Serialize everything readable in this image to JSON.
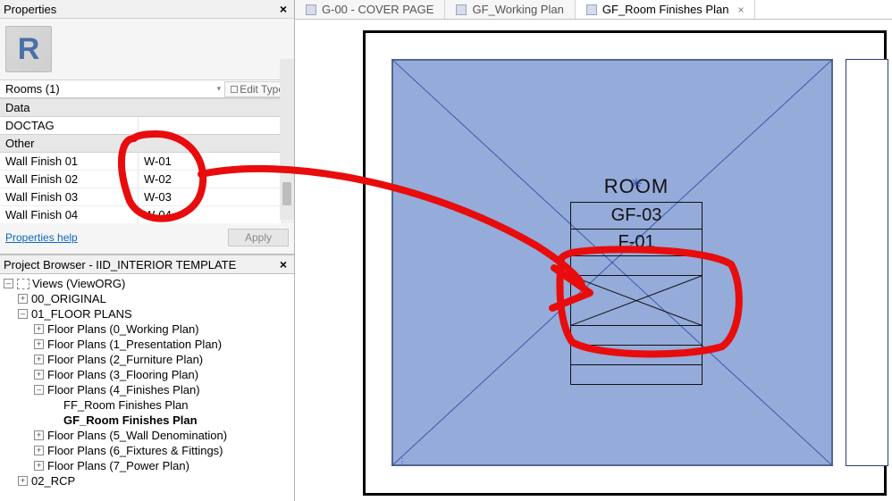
{
  "properties": {
    "panelTitle": "Properties",
    "typeLetter": "R",
    "instanceSelector": "Rooms (1)",
    "editType": "Edit Type",
    "sections": [
      {
        "title": "Data",
        "rows": [
          {
            "label": "DOCTAG",
            "value": ""
          }
        ]
      },
      {
        "title": "Other",
        "rows": [
          {
            "label": "Wall Finish 01",
            "value": "W-01"
          },
          {
            "label": "Wall Finish 02",
            "value": "W-02"
          },
          {
            "label": "Wall Finish 03",
            "value": "W-03"
          },
          {
            "label": "Wall Finish 04",
            "value": "W-04"
          }
        ]
      }
    ],
    "helpLink": "Properties help",
    "applyLabel": "Apply"
  },
  "browser": {
    "title": "Project Browser - IID_INTERIOR TEMPLATE",
    "nodes": [
      {
        "ind": 0,
        "tw": "-",
        "icon": true,
        "label": "Views (ViewORG)"
      },
      {
        "ind": 1,
        "tw": "+",
        "label": "00_ORIGINAL"
      },
      {
        "ind": 1,
        "tw": "-",
        "label": "01_FLOOR PLANS"
      },
      {
        "ind": 2,
        "tw": "+",
        "label": "Floor Plans (0_Working Plan)"
      },
      {
        "ind": 2,
        "tw": "+",
        "label": "Floor Plans (1_Presentation Plan)"
      },
      {
        "ind": 2,
        "tw": "+",
        "label": "Floor Plans (2_Furniture Plan)"
      },
      {
        "ind": 2,
        "tw": "+",
        "label": "Floor Plans (3_Flooring Plan)"
      },
      {
        "ind": 2,
        "tw": "-",
        "label": "Floor Plans (4_Finishes Plan)"
      },
      {
        "ind": 3,
        "tw": " ",
        "label": "FF_Room Finishes Plan"
      },
      {
        "ind": 3,
        "tw": " ",
        "bold": true,
        "label": "GF_Room Finishes Plan"
      },
      {
        "ind": 2,
        "tw": "+",
        "label": "Floor Plans (5_Wall Denomination)"
      },
      {
        "ind": 2,
        "tw": "+",
        "label": "Floor Plans (6_Fixtures & Fittings)"
      },
      {
        "ind": 2,
        "tw": "+",
        "label": "Floor Plans (7_Power Plan)"
      },
      {
        "ind": 1,
        "tw": "+",
        "label": "02_RCP"
      }
    ]
  },
  "tabs": [
    {
      "label": "G-00 - COVER PAGE",
      "active": false,
      "closable": false
    },
    {
      "label": "GF_Working Plan",
      "active": false,
      "closable": false
    },
    {
      "label": "GF_Room Finishes Plan",
      "active": true,
      "closable": true
    }
  ],
  "roomTag": {
    "title": "ROOM",
    "number": "GF-03",
    "finish": "F-01"
  }
}
